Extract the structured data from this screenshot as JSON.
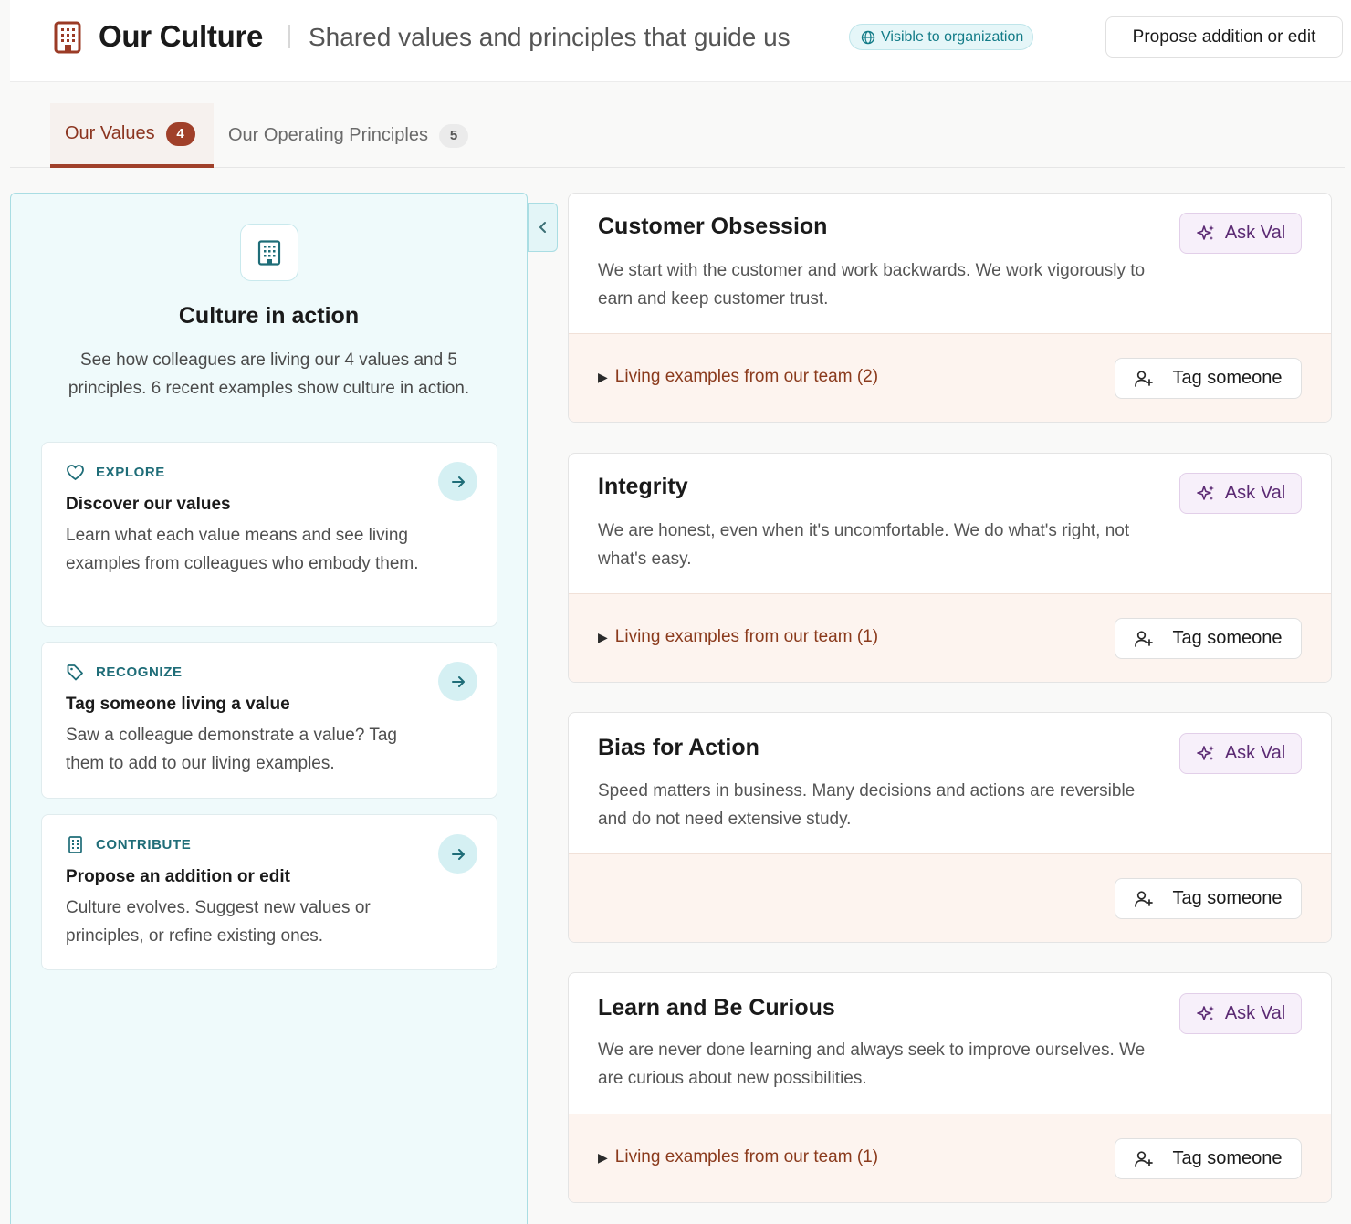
{
  "header": {
    "title": "Our Culture",
    "subtitle": "Shared values and principles that guide us",
    "visibility_badge": "Visible to organization",
    "propose_button": "Propose addition or edit",
    "icon": "building-icon"
  },
  "tabs": [
    {
      "label": "Our Values",
      "count": "4",
      "active": true
    },
    {
      "label": "Our Operating Principles",
      "count": "5",
      "active": false
    }
  ],
  "sidebar": {
    "icon": "building-icon",
    "title": "Culture in action",
    "description": "See how colleagues are living our 4 values and 5 principles. 6 recent examples show culture in action.",
    "cards": [
      {
        "kicker": "EXPLORE",
        "icon": "heart-icon",
        "title": "Discover our values",
        "description": "Learn what each value means and see living examples from colleagues who embody them."
      },
      {
        "kicker": "RECOGNIZE",
        "icon": "tag-icon",
        "title": "Tag someone living a value",
        "description": "Saw a colleague demonstrate a value? Tag them to add to our living examples."
      },
      {
        "kicker": "CONTRIBUTE",
        "icon": "building-icon",
        "title": "Propose an addition or edit",
        "description": "Culture evolves. Suggest new values or principles, or refine existing ones."
      }
    ]
  },
  "values": [
    {
      "title": "Customer Obsession",
      "description": "We start with the customer and work backwards. We work vigorously to earn and keep customer trust.",
      "ask_label": "Ask Val",
      "living_label": "Living examples from our team (2)",
      "tag_label": "Tag someone"
    },
    {
      "title": "Integrity",
      "description": "We are honest, even when it's uncomfortable. We do what's right, not what's easy.",
      "ask_label": "Ask Val",
      "living_label": "Living examples from our team (1)",
      "tag_label": "Tag someone"
    },
    {
      "title": "Bias for Action",
      "description": "Speed matters in business. Many decisions and actions are reversible and do not need extensive study.",
      "ask_label": "Ask Val",
      "living_label": "",
      "tag_label": "Tag someone"
    },
    {
      "title": "Learn and Be Curious",
      "description": "We are never done learning and always seek to improve ourselves. We are curious about new possibilities.",
      "ask_label": "Ask Val",
      "living_label": "Living examples from our team (1)",
      "tag_label": "Tag someone"
    }
  ],
  "colors": {
    "accent": "#a0402a",
    "teal": "#1f6d78",
    "purple": "#5b2a73"
  }
}
